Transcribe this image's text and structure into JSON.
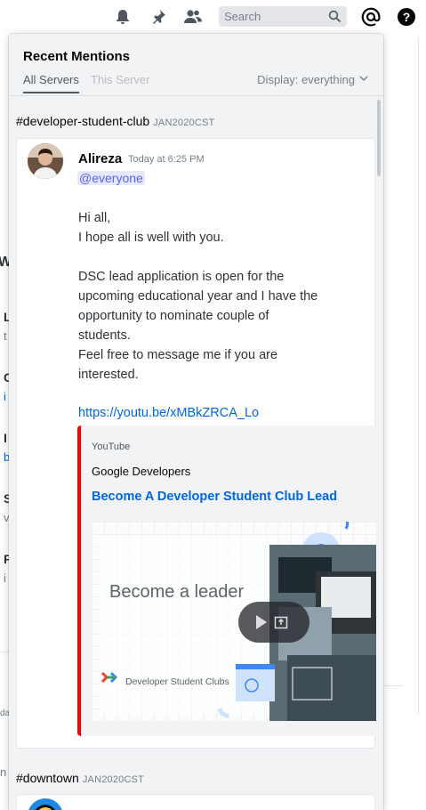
{
  "toolbar": {
    "icons": [
      "bell-icon",
      "pin-icon",
      "members-icon",
      "mention-icon",
      "help-icon"
    ],
    "search_placeholder": "Search"
  },
  "background": {
    "heading_glyph": "W",
    "letters": [
      "L",
      "t",
      "C",
      "i",
      "I",
      "b",
      "S",
      "v",
      "F",
      "i"
    ],
    "bottom_texts": [
      "da",
      "n"
    ]
  },
  "popout": {
    "title": "Recent Mentions",
    "tabs": [
      {
        "label": "All Servers",
        "active": true
      },
      {
        "label": "This Server",
        "active": false
      }
    ],
    "display_filter": "Display: everything"
  },
  "mentions": [
    {
      "channel": "#developer-student-club",
      "server": "JAN2020CST",
      "author": "Alireza",
      "timestamp": "Today at 6:25 PM",
      "mention": "@everyone",
      "lines": [
        "Hi all,",
        "I hope all is well with you.",
        "",
        "DSC lead application is open for the",
        "upcoming educational year and I have the",
        "opportunity to nominate couple of",
        "students.",
        "Feel free to message me if you are",
        "interested."
      ],
      "link": "https://youtu.be/xMBkZRCA_Lo",
      "embed": {
        "provider": "YouTube",
        "author": "Google Developers",
        "title": "Become A Developer Student Club Lead",
        "thumbnail_headline": "Become a leader",
        "thumbnail_logo_text": "Developer Student Clubs",
        "accent_color": "#ff0000"
      }
    },
    {
      "channel": "#downtown",
      "server": "JAN2020CST"
    }
  ],
  "colors": {
    "link": "#0067e0",
    "mention": "#5865f2",
    "popout_bg": "#f2f3f5"
  }
}
